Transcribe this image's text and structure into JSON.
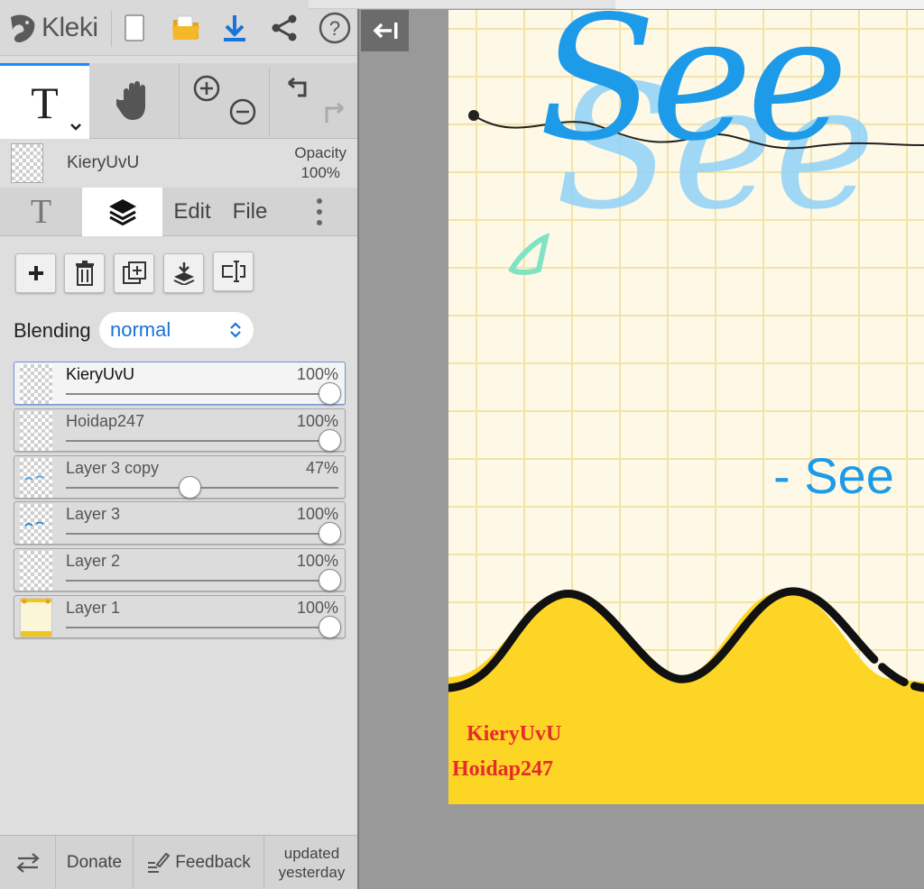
{
  "app": {
    "name": "Kleki"
  },
  "toolbar": {
    "logo": "Kleki",
    "icons": [
      "new-image-icon",
      "open-folder-icon",
      "download-icon",
      "share-icon",
      "help-icon"
    ]
  },
  "tools": {
    "active": "text",
    "items": [
      "text-tool-icon",
      "hand-tool-icon",
      "zoom-in-icon",
      "zoom-out-icon",
      "undo-icon",
      "redo-icon"
    ]
  },
  "current_layer": {
    "name": "KieryUvU",
    "opacity_label": "Opacity",
    "opacity_value": "100%"
  },
  "tabs": [
    {
      "label": "",
      "icon": "text-tab-icon"
    },
    {
      "label": "",
      "icon": "layers-icon",
      "active": true
    },
    {
      "label": "Edit"
    },
    {
      "label": "File"
    },
    {
      "label": "",
      "icon": "more-vertical-icon"
    }
  ],
  "layer_actions": [
    "add-layer-icon",
    "delete-layer-icon",
    "duplicate-layer-icon",
    "merge-down-icon",
    "rename-layer-icon"
  ],
  "blending": {
    "label": "Blending",
    "value": "normal"
  },
  "layers": [
    {
      "name": "KieryUvU",
      "opacity": "100%",
      "level": 1.0,
      "selected": true
    },
    {
      "name": "Hoidap247",
      "opacity": "100%",
      "level": 1.0
    },
    {
      "name": "Layer 3 copy",
      "opacity": "47%",
      "level": 0.47
    },
    {
      "name": "Layer 3",
      "opacity": "100%",
      "level": 1.0
    },
    {
      "name": "Layer 2",
      "opacity": "100%",
      "level": 1.0
    },
    {
      "name": "Layer 1",
      "opacity": "100%",
      "level": 1.0
    }
  ],
  "bottombar": {
    "swap_icon": "swap-arrows-icon",
    "donate": "Donate",
    "feedback": "Feedback",
    "updated_line1": "updated",
    "updated_line2": "yesterday"
  },
  "canvas": {
    "title_text": "See",
    "subtitle_text": "- See",
    "credit_1": "KieryUvU",
    "credit_2": "Hoidap247"
  },
  "colors": {
    "accent": "#1a8aff",
    "canvas_yellow": "#fdd525",
    "canvas_paper": "#fdf9e6",
    "title_blue": "#1e9be8",
    "credit_red": "#e52b2b"
  }
}
